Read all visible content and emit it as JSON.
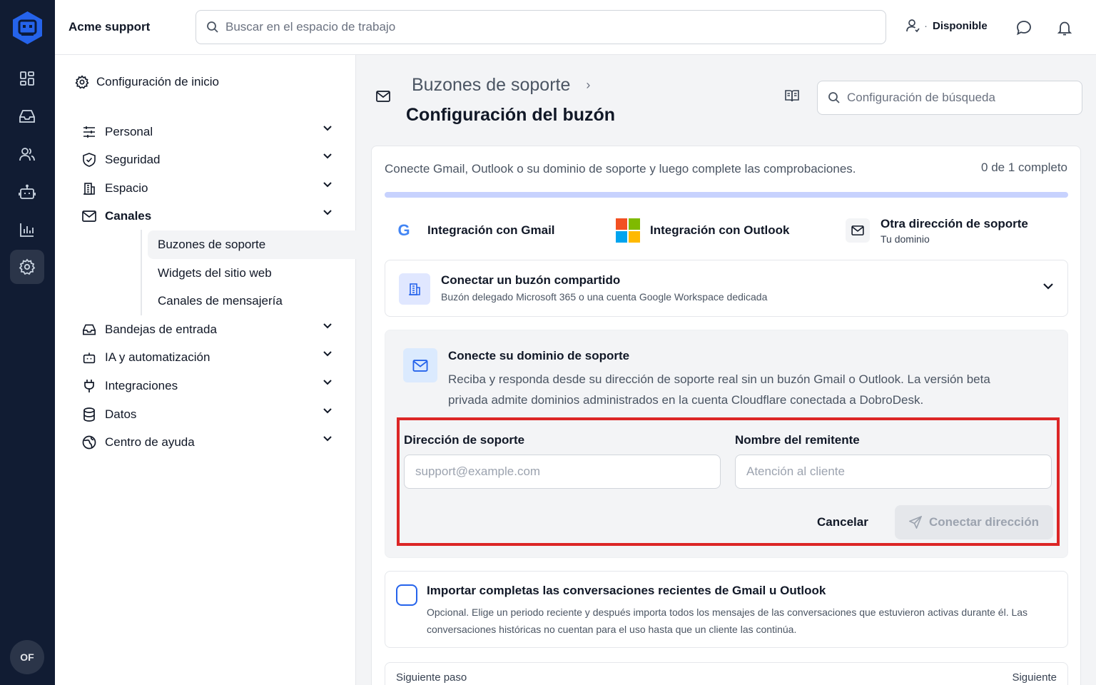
{
  "app": {
    "workspace_name": "Acme support",
    "search_placeholder": "Buscar en el espacio de trabajo",
    "status_label": "Disponible",
    "avatar_initials": "OF"
  },
  "rail": {
    "icons": [
      "dashboard-icon",
      "inbox-icon",
      "users-icon",
      "bot-icon",
      "chart-icon",
      "settings-icon"
    ],
    "active": "settings-icon"
  },
  "sidebar": {
    "header": "Configuración de inicio",
    "items": [
      {
        "label": "Personal",
        "icon": "sliders-icon"
      },
      {
        "label": "Seguridad",
        "icon": "shield-icon"
      },
      {
        "label": "Espacio",
        "icon": "building-icon"
      },
      {
        "label": "Canales",
        "icon": "mail-icon"
      },
      {
        "label": "Bandejas de entrada",
        "icon": "inbox-icon"
      },
      {
        "label": "IA y automatización",
        "icon": "bot-icon"
      },
      {
        "label": "Integraciones",
        "icon": "plug-icon"
      },
      {
        "label": "Datos",
        "icon": "database-icon"
      },
      {
        "label": "Centro de ayuda",
        "icon": "globe-icon"
      }
    ],
    "subitems": [
      {
        "label": "Buzones de soporte"
      },
      {
        "label": "Widgets del sitio web"
      },
      {
        "label": "Canales de mensajería"
      }
    ]
  },
  "main": {
    "breadcrumb": "Buzones de soporte",
    "title": "Configuración del buzón",
    "settings_search_placeholder": "Configuración de búsqueda",
    "intro": "Conecte Gmail, Outlook o su dominio de soporte y luego complete las comprobaciones.",
    "progress_text": "0 de 1 completo",
    "progress_fraction": 0,
    "options": {
      "gmail": {
        "icon_letter": "G",
        "label": "Integración con Gmail"
      },
      "outlook": {
        "label": "Integración con Outlook"
      },
      "other": {
        "label": "Otra dirección de soporte",
        "sub": "Tu dominio"
      }
    },
    "shared": {
      "title": "Conectar un buzón compartido",
      "desc": "Buzón delegado Microsoft 365 o una cuenta Google Workspace dedicada"
    },
    "domain": {
      "title": "Conecte su dominio de soporte",
      "desc": "Reciba y responda desde su dirección de soporte real sin un buzón Gmail o Outlook. La versión beta privada admite dominios administrados en la cuenta Cloudflare conectada a DobroDesk."
    },
    "form": {
      "address_label": "Dirección de soporte",
      "address_placeholder": "support@example.com",
      "sender_label": "Nombre del remitente",
      "sender_placeholder": "Atención al cliente",
      "cancel_label": "Cancelar",
      "connect_label": "Conectar dirección"
    },
    "import": {
      "title": "Importar completas las conversaciones recientes de Gmail u Outlook",
      "desc": "Opcional. Elige un periodo reciente y después importa todos los mensajes de las conversaciones que estuvieron activas durante él. Las conversaciones históricas no cuentan para el uso hasta que un cliente las continúa."
    },
    "next": {
      "left": "Siguiente paso",
      "right": "Siguiente"
    }
  },
  "colors": {
    "rail_bg": "#111c33",
    "accent": "#2563eb",
    "highlight_border": "#dc2626",
    "ms_red": "#f25022",
    "ms_green": "#7fba00",
    "ms_blue": "#00a4ef",
    "ms_yellow": "#ffb900"
  }
}
